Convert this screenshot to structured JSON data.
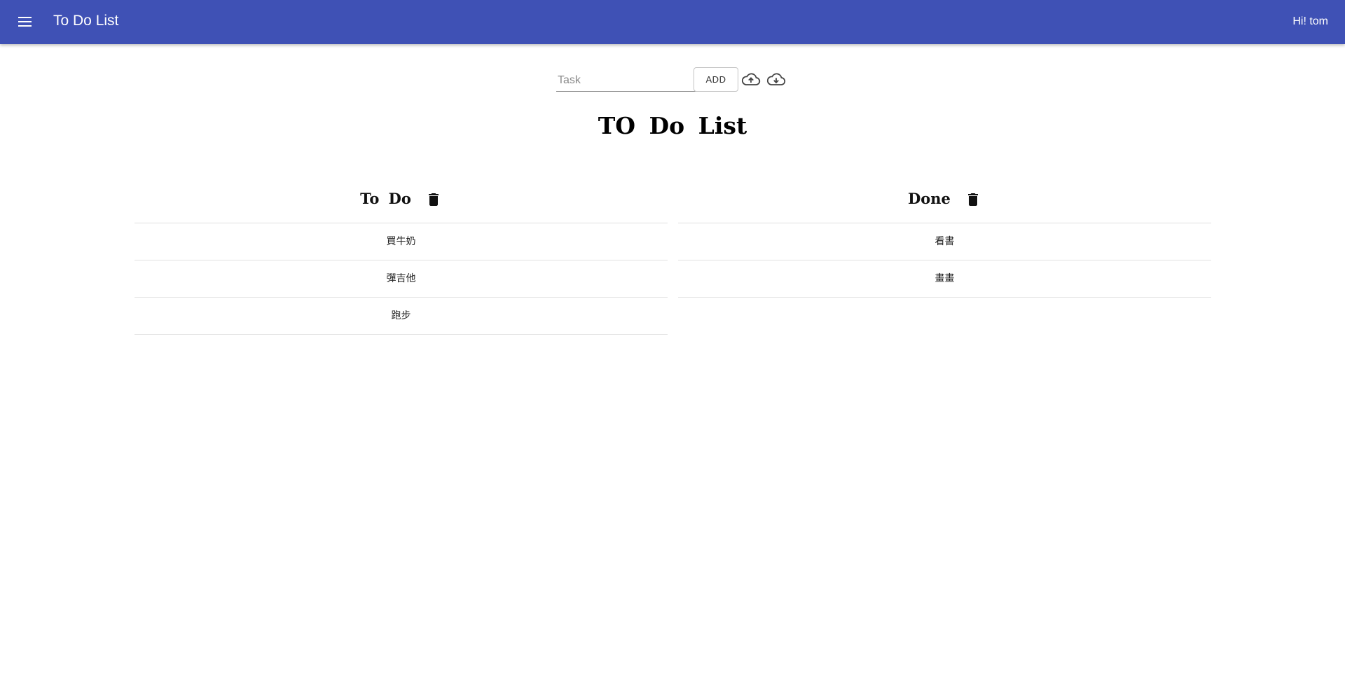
{
  "appbar": {
    "title": "To Do List",
    "greeting": "Hi! tom",
    "menu_icon": "menu-icon",
    "color": "#3f51b5"
  },
  "task_form": {
    "placeholder": "Task",
    "value": "",
    "add_label": "ADD",
    "upload_icon": "cloud-upload-icon",
    "download_icon": "cloud-download-icon"
  },
  "main": {
    "title": "TO  Do  List"
  },
  "todo": {
    "title": "To  Do",
    "trash_icon": "trash-icon",
    "items": [
      "買牛奶",
      "彈吉他",
      "跑步"
    ]
  },
  "done": {
    "title": "Done",
    "trash_icon": "trash-icon",
    "items": [
      "看書",
      "畫畫"
    ]
  }
}
